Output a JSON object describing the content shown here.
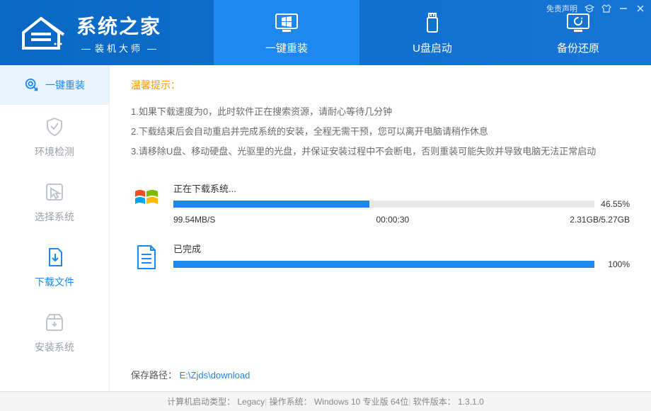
{
  "header": {
    "app_title": "系统之家",
    "app_subtitle": "装机大师",
    "disclaimer": "免责声明",
    "tabs": [
      {
        "label": "一键重装",
        "active": true
      },
      {
        "label": "U盘启动",
        "active": false
      },
      {
        "label": "备份还原",
        "active": false
      }
    ]
  },
  "sidebar": {
    "top": {
      "label": "一键重装"
    },
    "items": [
      {
        "label": "环境检测",
        "active": false
      },
      {
        "label": "选择系统",
        "active": false
      },
      {
        "label": "下载文件",
        "active": true
      },
      {
        "label": "安装系统",
        "active": false
      }
    ]
  },
  "tips": {
    "title": "温馨提示：",
    "lines": [
      "1.如果下载速度为0，此时软件正在搜索资源，请耐心等待几分钟",
      "2.下载结束后会自动重启并完成系统的安装，全程无需干预，您可以离开电脑请稍作休息",
      "3.请移除U盘、移动硬盘、光驱里的光盘，并保证安装过程中不会断电，否则重装可能失败并导致电脑无法正常启动"
    ]
  },
  "download": {
    "system": {
      "label": "正在下载系统...",
      "percent": 46.55,
      "percent_text": "46.55%",
      "speed": "99.54MB/S",
      "elapsed": "00:00:30",
      "size": "2.31GB/5.27GB"
    },
    "done": {
      "label": "已完成",
      "percent": 100,
      "percent_text": "100%"
    }
  },
  "save_path": {
    "label": "保存路径：",
    "value": "E:\\Zjds\\download"
  },
  "footer": {
    "boot_type": "计算机启动类型： Legacy",
    "os": "操作系统： Windows 10 专业版 64位",
    "version": "软件版本： 1.3.1.0"
  }
}
